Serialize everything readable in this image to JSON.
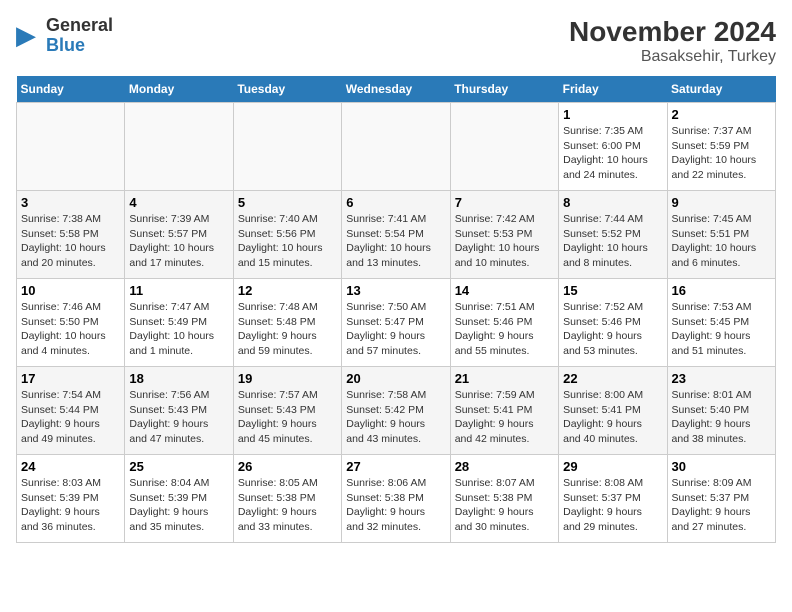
{
  "logo": {
    "line1": "General",
    "line2": "Blue"
  },
  "title": "November 2024",
  "subtitle": "Basaksehir, Turkey",
  "weekdays": [
    "Sunday",
    "Monday",
    "Tuesday",
    "Wednesday",
    "Thursday",
    "Friday",
    "Saturday"
  ],
  "weeks": [
    [
      {
        "day": "",
        "info": ""
      },
      {
        "day": "",
        "info": ""
      },
      {
        "day": "",
        "info": ""
      },
      {
        "day": "",
        "info": ""
      },
      {
        "day": "",
        "info": ""
      },
      {
        "day": "1",
        "info": "Sunrise: 7:35 AM\nSunset: 6:00 PM\nDaylight: 10 hours\nand 24 minutes."
      },
      {
        "day": "2",
        "info": "Sunrise: 7:37 AM\nSunset: 5:59 PM\nDaylight: 10 hours\nand 22 minutes."
      }
    ],
    [
      {
        "day": "3",
        "info": "Sunrise: 7:38 AM\nSunset: 5:58 PM\nDaylight: 10 hours\nand 20 minutes."
      },
      {
        "day": "4",
        "info": "Sunrise: 7:39 AM\nSunset: 5:57 PM\nDaylight: 10 hours\nand 17 minutes."
      },
      {
        "day": "5",
        "info": "Sunrise: 7:40 AM\nSunset: 5:56 PM\nDaylight: 10 hours\nand 15 minutes."
      },
      {
        "day": "6",
        "info": "Sunrise: 7:41 AM\nSunset: 5:54 PM\nDaylight: 10 hours\nand 13 minutes."
      },
      {
        "day": "7",
        "info": "Sunrise: 7:42 AM\nSunset: 5:53 PM\nDaylight: 10 hours\nand 10 minutes."
      },
      {
        "day": "8",
        "info": "Sunrise: 7:44 AM\nSunset: 5:52 PM\nDaylight: 10 hours\nand 8 minutes."
      },
      {
        "day": "9",
        "info": "Sunrise: 7:45 AM\nSunset: 5:51 PM\nDaylight: 10 hours\nand 6 minutes."
      }
    ],
    [
      {
        "day": "10",
        "info": "Sunrise: 7:46 AM\nSunset: 5:50 PM\nDaylight: 10 hours\nand 4 minutes."
      },
      {
        "day": "11",
        "info": "Sunrise: 7:47 AM\nSunset: 5:49 PM\nDaylight: 10 hours\nand 1 minute."
      },
      {
        "day": "12",
        "info": "Sunrise: 7:48 AM\nSunset: 5:48 PM\nDaylight: 9 hours\nand 59 minutes."
      },
      {
        "day": "13",
        "info": "Sunrise: 7:50 AM\nSunset: 5:47 PM\nDaylight: 9 hours\nand 57 minutes."
      },
      {
        "day": "14",
        "info": "Sunrise: 7:51 AM\nSunset: 5:46 PM\nDaylight: 9 hours\nand 55 minutes."
      },
      {
        "day": "15",
        "info": "Sunrise: 7:52 AM\nSunset: 5:46 PM\nDaylight: 9 hours\nand 53 minutes."
      },
      {
        "day": "16",
        "info": "Sunrise: 7:53 AM\nSunset: 5:45 PM\nDaylight: 9 hours\nand 51 minutes."
      }
    ],
    [
      {
        "day": "17",
        "info": "Sunrise: 7:54 AM\nSunset: 5:44 PM\nDaylight: 9 hours\nand 49 minutes."
      },
      {
        "day": "18",
        "info": "Sunrise: 7:56 AM\nSunset: 5:43 PM\nDaylight: 9 hours\nand 47 minutes."
      },
      {
        "day": "19",
        "info": "Sunrise: 7:57 AM\nSunset: 5:43 PM\nDaylight: 9 hours\nand 45 minutes."
      },
      {
        "day": "20",
        "info": "Sunrise: 7:58 AM\nSunset: 5:42 PM\nDaylight: 9 hours\nand 43 minutes."
      },
      {
        "day": "21",
        "info": "Sunrise: 7:59 AM\nSunset: 5:41 PM\nDaylight: 9 hours\nand 42 minutes."
      },
      {
        "day": "22",
        "info": "Sunrise: 8:00 AM\nSunset: 5:41 PM\nDaylight: 9 hours\nand 40 minutes."
      },
      {
        "day": "23",
        "info": "Sunrise: 8:01 AM\nSunset: 5:40 PM\nDaylight: 9 hours\nand 38 minutes."
      }
    ],
    [
      {
        "day": "24",
        "info": "Sunrise: 8:03 AM\nSunset: 5:39 PM\nDaylight: 9 hours\nand 36 minutes."
      },
      {
        "day": "25",
        "info": "Sunrise: 8:04 AM\nSunset: 5:39 PM\nDaylight: 9 hours\nand 35 minutes."
      },
      {
        "day": "26",
        "info": "Sunrise: 8:05 AM\nSunset: 5:38 PM\nDaylight: 9 hours\nand 33 minutes."
      },
      {
        "day": "27",
        "info": "Sunrise: 8:06 AM\nSunset: 5:38 PM\nDaylight: 9 hours\nand 32 minutes."
      },
      {
        "day": "28",
        "info": "Sunrise: 8:07 AM\nSunset: 5:38 PM\nDaylight: 9 hours\nand 30 minutes."
      },
      {
        "day": "29",
        "info": "Sunrise: 8:08 AM\nSunset: 5:37 PM\nDaylight: 9 hours\nand 29 minutes."
      },
      {
        "day": "30",
        "info": "Sunrise: 8:09 AM\nSunset: 5:37 PM\nDaylight: 9 hours\nand 27 minutes."
      }
    ]
  ]
}
